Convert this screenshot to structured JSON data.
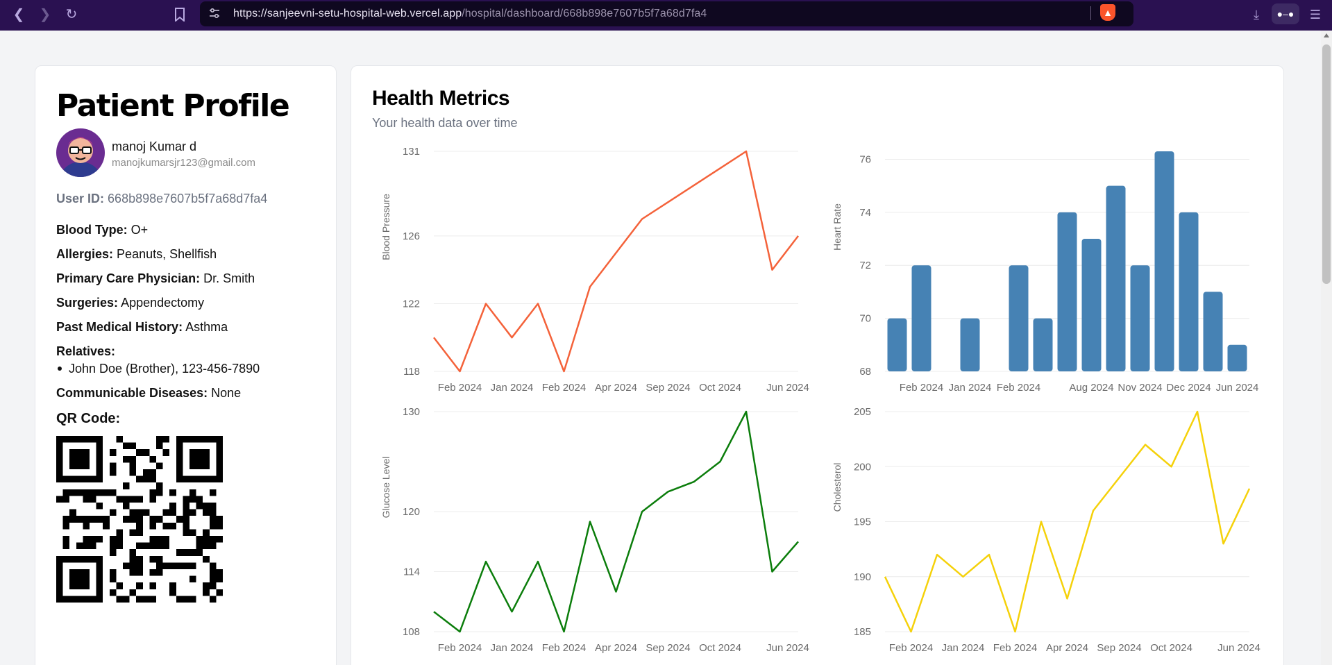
{
  "browser": {
    "url_host": "https://sanjeevni-setu-hospital-web.vercel.app",
    "url_path": "/hospital/dashboard/668b898e7607b5f7a68d7fa4"
  },
  "profile": {
    "title": "Patient Profile",
    "name": "manoj Kumar d",
    "email": "manojkumarsjr123@gmail.com",
    "user_id_label": "User ID:",
    "user_id": "668b898e7607b5f7a68d7fa4",
    "blood_type_label": "Blood Type:",
    "blood_type": "O+",
    "allergies_label": "Allergies:",
    "allergies": "Peanuts, Shellfish",
    "physician_label": "Primary Care Physician:",
    "physician": "Dr. Smith",
    "surgeries_label": "Surgeries:",
    "surgeries": "Appendectomy",
    "history_label": "Past Medical History:",
    "history": "Asthma",
    "relatives_label": "Relatives:",
    "relatives": [
      "John Doe (Brother), 123-456-7890"
    ],
    "diseases_label": "Communicable Diseases:",
    "diseases": "None",
    "qr_label": "QR Code:"
  },
  "metrics": {
    "title": "Health Metrics",
    "subtitle": "Your health data over time"
  },
  "chart_data": [
    {
      "id": "bp",
      "type": "line",
      "ylabel": "Blood Pressure",
      "color": "#f4623a",
      "ylim": [
        118,
        131
      ],
      "yticks": [
        118,
        122,
        126,
        131
      ],
      "values": [
        120,
        118,
        122,
        120,
        122,
        118,
        123,
        125,
        127,
        128,
        129,
        130,
        131,
        124,
        126
      ],
      "xticks": [
        {
          "i": 1,
          "label": "Feb 2024"
        },
        {
          "i": 3,
          "label": "Jan 2024"
        },
        {
          "i": 5,
          "label": "Feb 2024"
        },
        {
          "i": 7,
          "label": "Apr 2024"
        },
        {
          "i": 9,
          "label": "Sep 2024"
        },
        {
          "i": 11,
          "label": "Oct 2024"
        },
        {
          "i": 13.6,
          "label": "Jun 2024"
        }
      ]
    },
    {
      "id": "hr",
      "type": "bar",
      "ylabel": "Heart Rate",
      "color": "#4682b4",
      "ylim": [
        68,
        76.3
      ],
      "yticks": [
        68,
        70,
        72,
        74,
        76
      ],
      "values": [
        70,
        72,
        68,
        70,
        68,
        72,
        70,
        74,
        73,
        75,
        72,
        76.3,
        74,
        71,
        69
      ],
      "xticks": [
        {
          "i": 1,
          "label": "Feb 2024"
        },
        {
          "i": 3,
          "label": "Jan 2024"
        },
        {
          "i": 5,
          "label": "Feb 2024"
        },
        {
          "i": 8,
          "label": "Aug 2024"
        },
        {
          "i": 10,
          "label": "Nov 2024"
        },
        {
          "i": 12,
          "label": "Dec 2024"
        },
        {
          "i": 14,
          "label": "Jun 2024"
        }
      ]
    },
    {
      "id": "glucose",
      "type": "line",
      "ylabel": "Glucose Level",
      "color": "#0b7d0b",
      "ylim": [
        108,
        130
      ],
      "yticks": [
        108,
        114,
        120,
        130
      ],
      "values": [
        110,
        108,
        115,
        110,
        115,
        108,
        119,
        112,
        120,
        122,
        123,
        125,
        131,
        114,
        117
      ],
      "xticks": [
        {
          "i": 1,
          "label": "Feb 2024"
        },
        {
          "i": 3,
          "label": "Jan 2024"
        },
        {
          "i": 5,
          "label": "Feb 2024"
        },
        {
          "i": 7,
          "label": "Apr 2024"
        },
        {
          "i": 9,
          "label": "Sep 2024"
        },
        {
          "i": 11,
          "label": "Oct 2024"
        },
        {
          "i": 13.6,
          "label": "Jun 2024"
        }
      ]
    },
    {
      "id": "chol",
      "type": "line",
      "ylabel": "Cholesterol",
      "color": "#f5d10a",
      "ylim": [
        185,
        205
      ],
      "yticks": [
        185,
        190,
        195,
        200,
        205
      ],
      "values": [
        190,
        185,
        192,
        190,
        192,
        185,
        195,
        188,
        196,
        199,
        202,
        200,
        206,
        193,
        198
      ],
      "xticks": [
        {
          "i": 1,
          "label": "Feb 2024"
        },
        {
          "i": 3,
          "label": "Jan 2024"
        },
        {
          "i": 5,
          "label": "Feb 2024"
        },
        {
          "i": 7,
          "label": "Apr 2024"
        },
        {
          "i": 9,
          "label": "Sep 2024"
        },
        {
          "i": 11,
          "label": "Oct 2024"
        },
        {
          "i": 13.6,
          "label": "Jun 2024"
        }
      ]
    }
  ]
}
